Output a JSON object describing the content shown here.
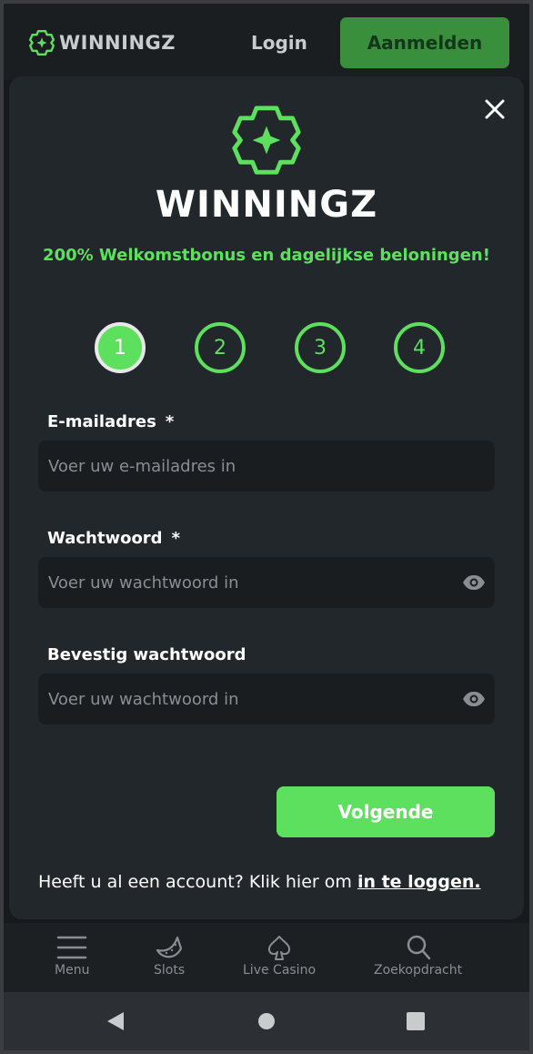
{
  "header": {
    "brand": "WINNINGZ",
    "login_label": "Login",
    "signup_label": "Aanmelden"
  },
  "modal": {
    "logo_text": "WINNINGZ",
    "promo": "200% Welkomstbonus en dagelijkse beloningen!",
    "steps": [
      "1",
      "2",
      "3",
      "4"
    ],
    "active_step": 1,
    "email": {
      "label": "E-mailadres",
      "required": "*",
      "placeholder": "Voer uw e-mailadres in"
    },
    "password": {
      "label": "Wachtwoord",
      "required": "*",
      "placeholder": "Voer uw wachtwoord in"
    },
    "confirm": {
      "label": "Bevestig wachtwoord",
      "placeholder": "Voer uw wachtwoord in"
    },
    "next_label": "Volgende",
    "account_text": "Heeft u al een account? Klik hier om ",
    "account_link": "in te loggen."
  },
  "nav": {
    "items": [
      {
        "label": "Menu",
        "icon": "menu-icon"
      },
      {
        "label": "Slots",
        "icon": "watermelon-icon"
      },
      {
        "label": "Live Casino",
        "icon": "spade-icon"
      },
      {
        "label": "Zoekopdracht",
        "icon": "search-icon"
      }
    ]
  },
  "colors": {
    "accent": "#5ee05f",
    "signup_bg": "#3a8f3c",
    "modal_bg": "#22272b",
    "field_bg": "#1a1d20"
  }
}
